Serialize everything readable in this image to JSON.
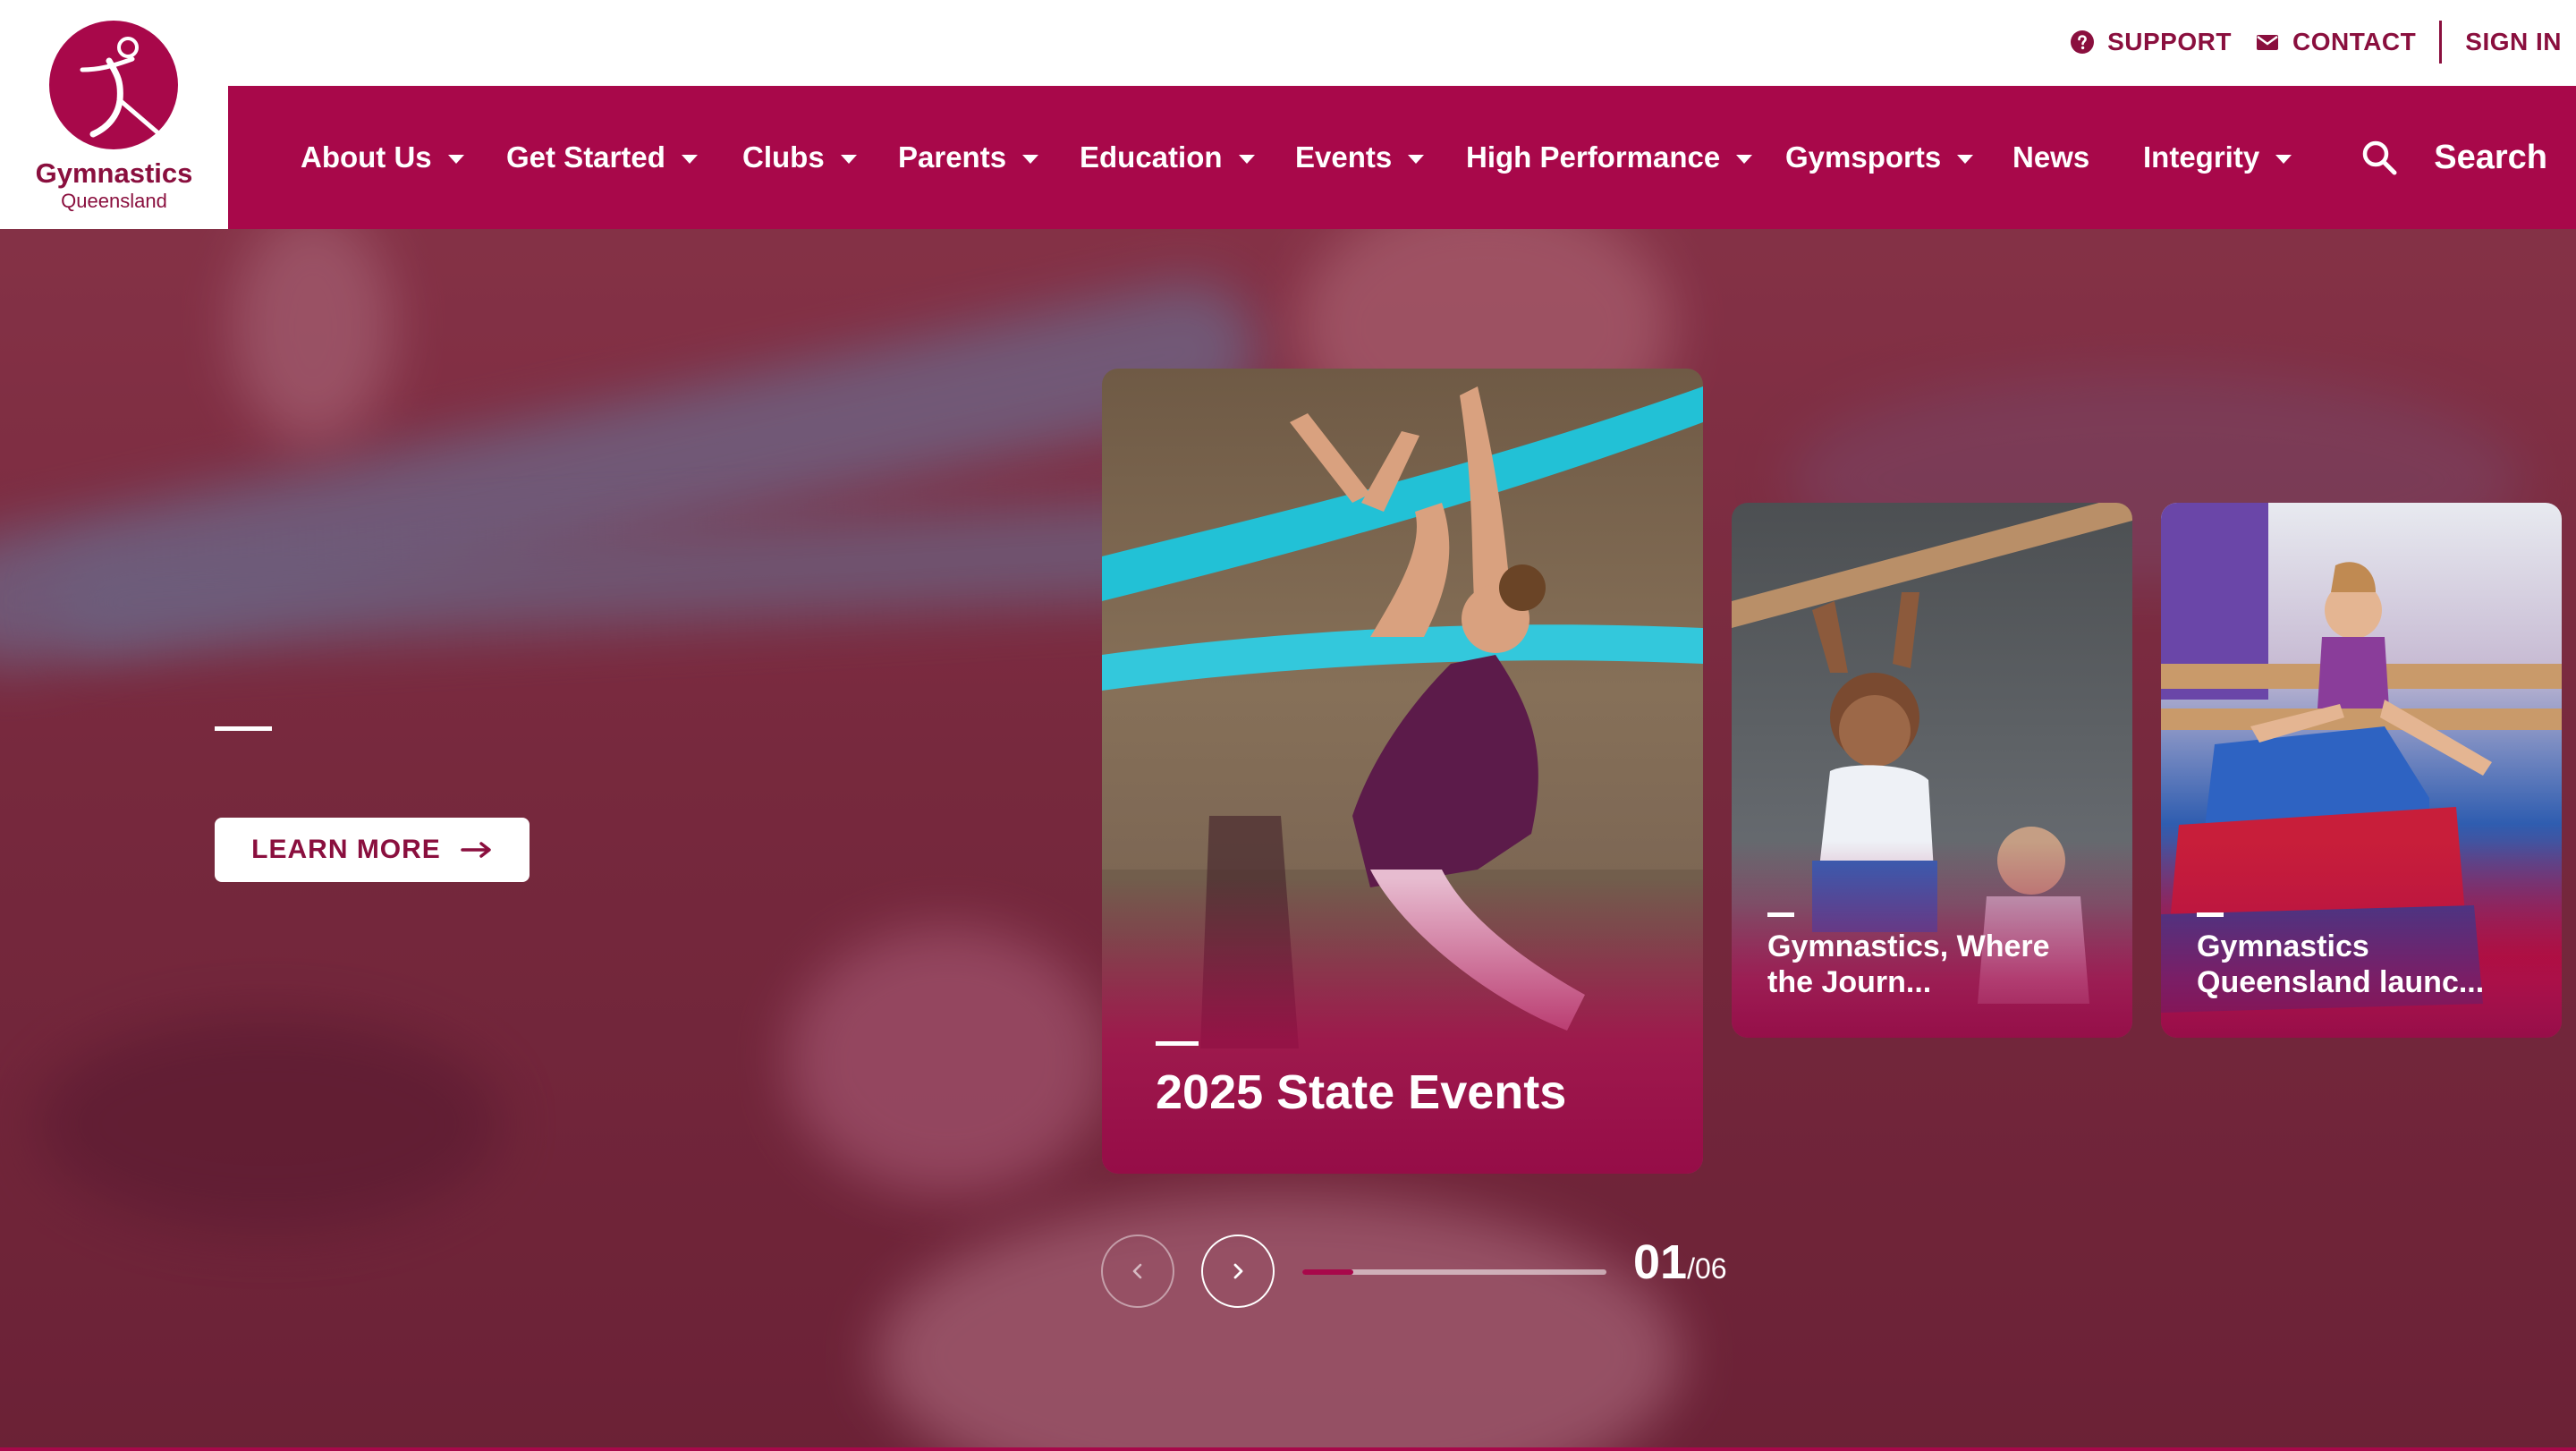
{
  "brand": {
    "name": "Gymnastics",
    "region": "Queensland",
    "primary_color": "#a8084a",
    "accent_color": "#8a0f3e"
  },
  "utility": {
    "support_label": "SUPPORT",
    "support_icon": "help-circle-icon",
    "contact_label": "CONTACT",
    "contact_icon": "envelope-icon",
    "signin_label": "SIGN IN"
  },
  "nav": {
    "items": [
      {
        "label": "About Us",
        "has_dropdown": true
      },
      {
        "label": "Get Started",
        "has_dropdown": true
      },
      {
        "label": "Clubs",
        "has_dropdown": true
      },
      {
        "label": "Parents",
        "has_dropdown": true
      },
      {
        "label": "Education",
        "has_dropdown": true
      },
      {
        "label": "Events",
        "has_dropdown": true
      },
      {
        "label": "High Performance",
        "has_dropdown": true
      },
      {
        "label": "Gymsports",
        "has_dropdown": true
      },
      {
        "label": "News",
        "has_dropdown": false
      },
      {
        "label": "Integrity",
        "has_dropdown": true
      }
    ],
    "search_label": "Search",
    "search_icon": "magnifier-icon"
  },
  "hero": {
    "cta_label": "LEARN MORE",
    "cta_icon": "arrow-right-icon"
  },
  "cards": [
    {
      "title": "2025 State Events"
    },
    {
      "title_line1": "Gymnastics, Where",
      "title_line2": "the Journ..."
    },
    {
      "title_line1": "Gymnastics",
      "title_line2": "Queensland launc..."
    }
  ],
  "slider": {
    "current": "01",
    "total": "/06",
    "progress_fraction": 0.167,
    "prev_icon": "chevron-left-icon",
    "next_icon": "chevron-right-icon"
  }
}
